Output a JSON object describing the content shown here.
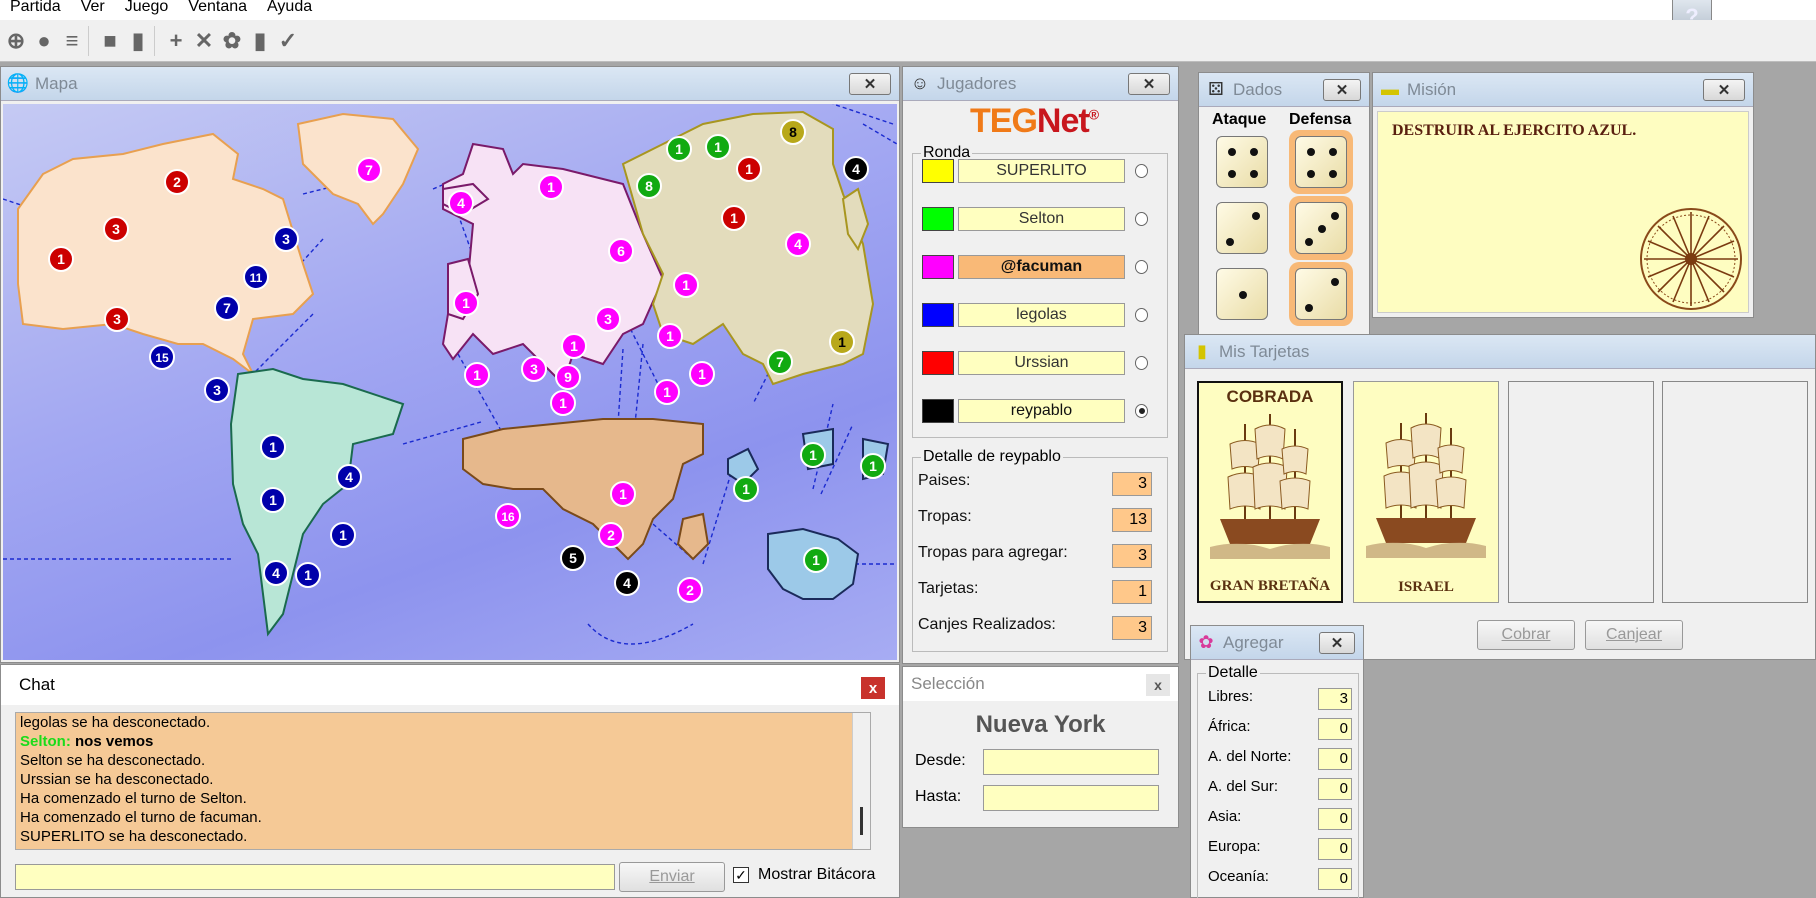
{
  "menu": {
    "items": [
      "Partida",
      "Ver",
      "Juego",
      "Ventana",
      "Ayuda"
    ]
  },
  "mapa": {
    "title": "Mapa"
  },
  "jugadores": {
    "title": "Jugadores",
    "logo_teg": "TEG",
    "logo_net": "Net",
    "logo_reg": "®",
    "ronda_label": "Ronda",
    "players": [
      {
        "name": "SUPERLITO",
        "color": "#ffff00",
        "active": false
      },
      {
        "name": "Selton",
        "color": "#00ff00",
        "active": false
      },
      {
        "name": "@facuman",
        "color": "#ff00ff",
        "active": false,
        "highlight": true
      },
      {
        "name": "legolas",
        "color": "#0000ff",
        "active": false
      },
      {
        "name": "Urssian",
        "color": "#ff0000",
        "active": false
      },
      {
        "name": "reypablo",
        "color": "#000000",
        "active": true
      }
    ],
    "detalle_label": "Detalle de reypablo",
    "details": [
      {
        "label": "Paises:",
        "value": "3"
      },
      {
        "label": "Tropas:",
        "value": "13"
      },
      {
        "label": "Tropas para agregar:",
        "value": "3"
      },
      {
        "label": "Tarjetas:",
        "value": "1"
      },
      {
        "label": "Canjes Realizados:",
        "value": "3"
      }
    ]
  },
  "dados": {
    "title": "Dados",
    "ataque": "Ataque",
    "defensa": "Defensa",
    "ataque_values": [
      4,
      2,
      1
    ],
    "defensa_values": [
      4,
      3,
      2
    ]
  },
  "mision": {
    "title": "Misión",
    "text": "DESTRUIR AL EJERCITO AZUL."
  },
  "tarjetas": {
    "title": "Mis Tarjetas",
    "cards": [
      {
        "top": "COBRADA",
        "bottom": "GRAN BRETAÑA"
      },
      {
        "top": "",
        "bottom": "ISRAEL"
      }
    ],
    "cobrar": "Cobrar",
    "canjear": "Canjear"
  },
  "chat": {
    "title": "Chat",
    "close": "x",
    "messages": [
      {
        "text": "legolas se ha desconectado."
      },
      {
        "speaker": "Selton:",
        "text": "nos vemos"
      },
      {
        "text": "Selton se ha desconectado."
      },
      {
        "text": "Urssian se ha desconectado."
      },
      {
        "text": "Ha comenzado el turno de Selton."
      },
      {
        "text": "Ha comenzado el turno de facuman."
      },
      {
        "text": "SUPERLITO se ha desconectado."
      }
    ],
    "enviar": "Enviar",
    "bitacora": "Mostrar Bitácora"
  },
  "seleccion": {
    "title": "Selección",
    "close": "x",
    "country": "Nueva York",
    "desde": "Desde:",
    "hasta": "Hasta:"
  },
  "agregar": {
    "title": "Agregar",
    "detalle": "Detalle",
    "rows": [
      {
        "label": "Libres:",
        "value": "3"
      },
      {
        "label": "África:",
        "value": "0"
      },
      {
        "label": "A. del Norte:",
        "value": "0"
      },
      {
        "label": "A. del Sur:",
        "value": "0"
      },
      {
        "label": "Asia:",
        "value": "0"
      },
      {
        "label": "Europa:",
        "value": "0"
      },
      {
        "label": "Oceanía:",
        "value": "0"
      }
    ]
  },
  "armies": [
    {
      "n": "7",
      "c": "#ff00ff"
    },
    {
      "n": "2",
      "c": "#cc0000"
    },
    {
      "n": "3",
      "c": "#cc0000"
    },
    {
      "n": "1",
      "c": "#cc0000"
    },
    {
      "n": "3",
      "c": "#0000aa"
    },
    {
      "n": "11",
      "c": "#0000aa"
    },
    {
      "n": "7",
      "c": "#0000aa"
    },
    {
      "n": "3",
      "c": "#cc0000"
    },
    {
      "n": "15",
      "c": "#0000aa"
    },
    {
      "n": "3",
      "c": "#0000aa"
    },
    {
      "n": "4",
      "c": "#ff00ff"
    },
    {
      "n": "1",
      "c": "#ff00ff"
    },
    {
      "n": "1",
      "c": "#ff00ff"
    },
    {
      "n": "6",
      "c": "#ff00ff"
    },
    {
      "n": "3",
      "c": "#ff00ff"
    },
    {
      "n": "1",
      "c": "#ff00ff"
    },
    {
      "n": "1",
      "c": "#ff00ff"
    },
    {
      "n": "3",
      "c": "#ff00ff"
    },
    {
      "n": "1",
      "c": "#ff00ff"
    },
    {
      "n": "9",
      "c": "#ff00ff"
    },
    {
      "n": "1",
      "c": "#ff00ff"
    },
    {
      "n": "1",
      "c": "#ff00ff"
    },
    {
      "n": "1",
      "c": "#ff00ff"
    },
    {
      "n": "1",
      "c": "#ff00ff"
    },
    {
      "n": "1",
      "c": "#11aa11"
    },
    {
      "n": "1",
      "c": "#11aa11"
    },
    {
      "n": "8",
      "c": "#b8a81a"
    },
    {
      "n": "8",
      "c": "#11aa11"
    },
    {
      "n": "1",
      "c": "#cc0000"
    },
    {
      "n": "1",
      "c": "#cc0000"
    },
    {
      "n": "4",
      "c": "#000000"
    },
    {
      "n": "4",
      "c": "#ff00ff"
    },
    {
      "n": "7",
      "c": "#11aa11"
    },
    {
      "n": "1",
      "c": "#b8a81a"
    },
    {
      "n": "1",
      "c": "#0000aa"
    },
    {
      "n": "4",
      "c": "#0000aa"
    },
    {
      "n": "1",
      "c": "#0000aa"
    },
    {
      "n": "1",
      "c": "#0000aa"
    },
    {
      "n": "4",
      "c": "#0000aa"
    },
    {
      "n": "1",
      "c": "#0000aa"
    },
    {
      "n": "16",
      "c": "#ff00ff"
    },
    {
      "n": "1",
      "c": "#ff00ff"
    },
    {
      "n": "2",
      "c": "#ff00ff"
    },
    {
      "n": "5",
      "c": "#000000"
    },
    {
      "n": "4",
      "c": "#000000"
    },
    {
      "n": "2",
      "c": "#ff00ff"
    },
    {
      "n": "1",
      "c": "#11aa11"
    },
    {
      "n": "1",
      "c": "#11aa11"
    },
    {
      "n": "1",
      "c": "#11aa11"
    },
    {
      "n": "1",
      "c": "#11aa11"
    }
  ]
}
